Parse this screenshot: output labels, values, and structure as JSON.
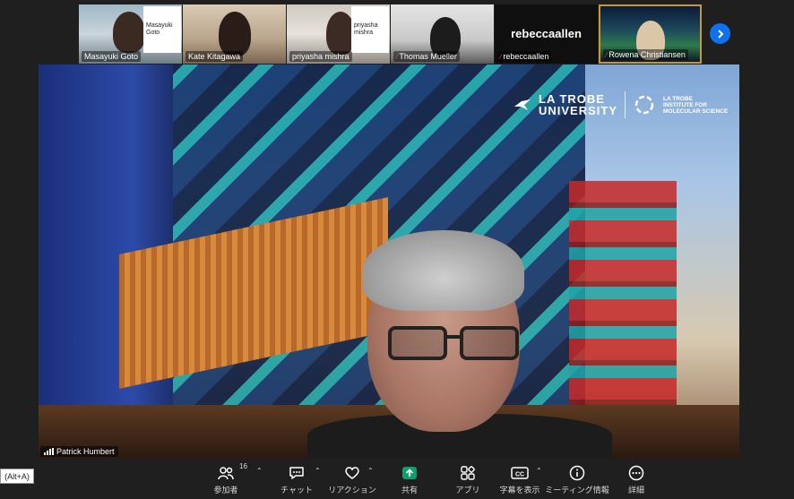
{
  "participants": [
    {
      "name": "Masayuki Goto",
      "muted": false,
      "slide_lines": [
        "Masayuki",
        "Goto"
      ]
    },
    {
      "name": "Kate Kitagawa",
      "muted": false
    },
    {
      "name": "priyasha mishra",
      "muted": false,
      "slide_lines": [
        "priyasha",
        "mishra"
      ]
    },
    {
      "name": "Thomas Mueller",
      "muted": true
    },
    {
      "name": "rebeccaallen",
      "muted": true,
      "display": "rebeccaallen"
    },
    {
      "name": "Rowena Christiansen",
      "muted": true
    }
  ],
  "main_video": {
    "speaker": "Patrick Humbert",
    "logo_university": [
      "LA TROBE",
      "UNIVERSITY"
    ],
    "logo_institute": [
      "LA TROBE",
      "INSTITUTE FOR",
      "MOLECULAR SCIENCE"
    ]
  },
  "tooltip": "(Alt+A)",
  "toolbar": [
    {
      "key": "participants",
      "label": "参加者",
      "badge": "16",
      "caret": true,
      "icon": "participants-icon"
    },
    {
      "key": "chat",
      "label": "チャット",
      "caret": true,
      "icon": "chat-icon"
    },
    {
      "key": "reaction",
      "label": "リアクション",
      "caret": true,
      "icon": "heart-icon"
    },
    {
      "key": "share",
      "label": "共有",
      "caret": false,
      "icon": "share-icon"
    },
    {
      "key": "apps",
      "label": "アプリ",
      "caret": false,
      "icon": "apps-icon"
    },
    {
      "key": "captions",
      "label": "字幕を表示",
      "caret": true,
      "icon": "cc-icon"
    },
    {
      "key": "info",
      "label": "ミーティング情報",
      "caret": false,
      "icon": "info-icon"
    },
    {
      "key": "more",
      "label": "詳細",
      "caret": false,
      "icon": "more-icon"
    }
  ],
  "colors": {
    "accent": "#0e72ed",
    "share_green": "#0e9f6e",
    "mute_red": "#e5484d"
  }
}
